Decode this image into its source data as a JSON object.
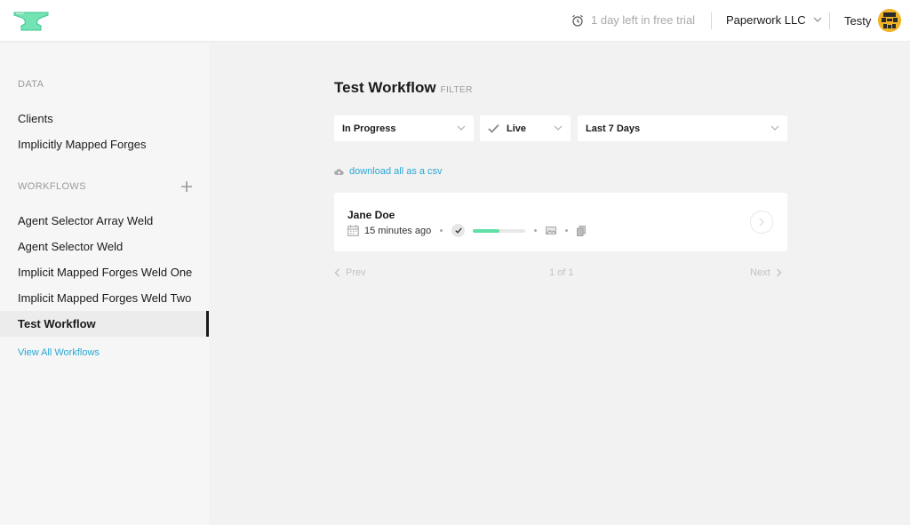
{
  "header": {
    "logo_icon": "anvil-logo-icon",
    "trial_icon": "alarm-clock-icon",
    "trial_text": "1 day left in free trial",
    "org_name": "Paperwork LLC",
    "user_name": "Testy",
    "brand_color": "#74e3b4",
    "link_color": "#27a8d8"
  },
  "sidebar": {
    "data_label": "DATA",
    "data_items": [
      "Clients",
      "Implicitly Mapped Forges"
    ],
    "workflows_label": "WORKFLOWS",
    "workflow_items": [
      "Agent Selector Array Weld",
      "Agent Selector Weld",
      "Implicit Mapped Forges Weld One",
      "Implicit Mapped Forges Weld Two",
      "Test Workflow"
    ],
    "active_workflow": "Test Workflow",
    "view_all": "View All Workflows"
  },
  "main": {
    "title": "Test Workflow",
    "filter_label": "FILTER",
    "filters": {
      "status": "In Progress",
      "mode": "Live",
      "range": "Last 7 Days"
    },
    "download_label": "download all as a csv",
    "submissions": [
      {
        "name": "Jane Doe",
        "time": "15 minutes ago",
        "progress": 0.5
      }
    ],
    "pagination": {
      "prev": "Prev",
      "page": "1 of 1",
      "next": "Next"
    }
  }
}
